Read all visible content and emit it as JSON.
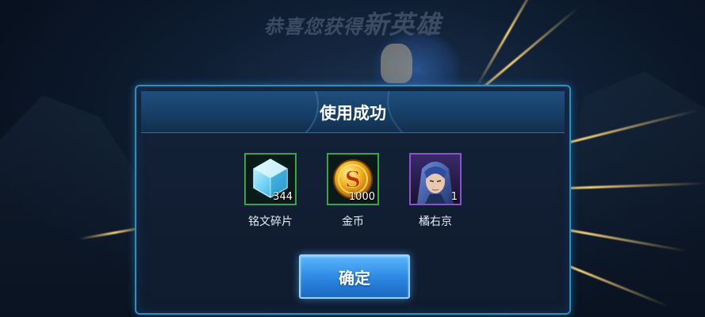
{
  "banner": {
    "prefix": "恭喜您获得",
    "highlight": "新英雄"
  },
  "dialog": {
    "title": "使用成功",
    "confirm_label": "确定"
  },
  "rewards": [
    {
      "name": "铭文碎片",
      "count": "344",
      "icon": "crystal-icon",
      "rarity_color": "#39a24a"
    },
    {
      "name": "金币",
      "count": "1000",
      "icon": "gold-coin-icon",
      "rarity_color": "#39a24a"
    },
    {
      "name": "橘右京",
      "count": "1",
      "icon": "hero-portrait",
      "rarity_color": "#8a54c8"
    }
  ],
  "colors": {
    "dialog_border": "#2d8fc0",
    "button": "#2a86e0",
    "ray": "#ffd678"
  }
}
